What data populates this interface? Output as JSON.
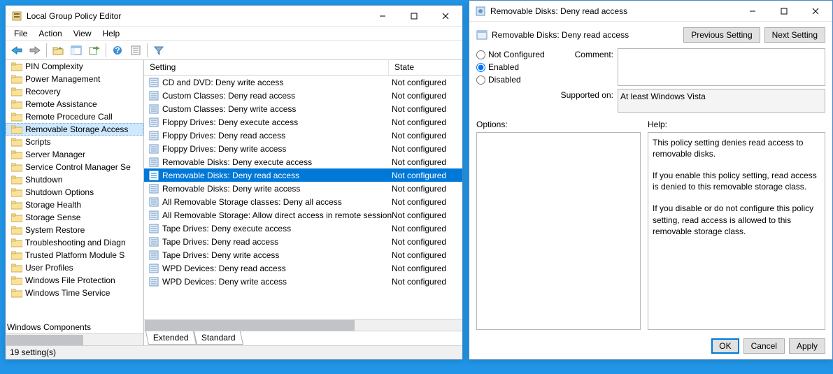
{
  "gpedit": {
    "title": "Local Group Policy Editor",
    "menus": [
      "File",
      "Action",
      "View",
      "Help"
    ],
    "columns": {
      "setting": "Setting",
      "state": "State"
    },
    "tree_items": [
      "PIN Complexity",
      "Power Management",
      "Recovery",
      "Remote Assistance",
      "Remote Procedure Call",
      "Removable Storage Access",
      "Scripts",
      "Server Manager",
      "Service Control Manager Se",
      "Shutdown",
      "Shutdown Options",
      "Storage Health",
      "Storage Sense",
      "System Restore",
      "Troubleshooting and Diagn",
      "Trusted Platform Module S",
      "User Profiles",
      "Windows File Protection",
      "Windows Time Service"
    ],
    "tree_tail": "Windows Components",
    "tree_selected_index": 5,
    "settings": [
      {
        "name": "CD and DVD: Deny write access",
        "state": "Not configured"
      },
      {
        "name": "Custom Classes: Deny read access",
        "state": "Not configured"
      },
      {
        "name": "Custom Classes: Deny write access",
        "state": "Not configured"
      },
      {
        "name": "Floppy Drives: Deny execute access",
        "state": "Not configured"
      },
      {
        "name": "Floppy Drives: Deny read access",
        "state": "Not configured"
      },
      {
        "name": "Floppy Drives: Deny write access",
        "state": "Not configured"
      },
      {
        "name": "Removable Disks: Deny execute access",
        "state": "Not configured"
      },
      {
        "name": "Removable Disks: Deny read access",
        "state": "Not configured"
      },
      {
        "name": "Removable Disks: Deny write access",
        "state": "Not configured"
      },
      {
        "name": "All Removable Storage classes: Deny all access",
        "state": "Not configured"
      },
      {
        "name": "All Removable Storage: Allow direct access in remote sessions",
        "state": "Not configured"
      },
      {
        "name": "Tape Drives: Deny execute access",
        "state": "Not configured"
      },
      {
        "name": "Tape Drives: Deny read access",
        "state": "Not configured"
      },
      {
        "name": "Tape Drives: Deny write access",
        "state": "Not configured"
      },
      {
        "name": "WPD Devices: Deny read access",
        "state": "Not configured"
      },
      {
        "name": "WPD Devices: Deny write access",
        "state": "Not configured"
      }
    ],
    "settings_selected_index": 7,
    "tabs": {
      "extended": "Extended",
      "standard": "Standard"
    },
    "status": "19 setting(s)"
  },
  "policy": {
    "title": "Removable Disks: Deny read access",
    "sub_title": "Removable Disks: Deny read access",
    "prev": "Previous Setting",
    "next": "Next Setting",
    "radios": {
      "not_configured": "Not Configured",
      "enabled": "Enabled",
      "disabled": "Disabled"
    },
    "radio_selected": "enabled",
    "comment_label": "Comment:",
    "comment_value": "",
    "supported_label": "Supported on:",
    "supported_value": "At least Windows Vista",
    "options_label": "Options:",
    "help_label": "Help:",
    "help_text_1": "This policy setting denies read access to removable disks.",
    "help_text_2": "If you enable this policy setting, read access is denied to this removable storage class.",
    "help_text_3": "If you disable or do not configure this policy setting, read access is allowed to this removable storage class.",
    "buttons": {
      "ok": "OK",
      "cancel": "Cancel",
      "apply": "Apply"
    }
  }
}
